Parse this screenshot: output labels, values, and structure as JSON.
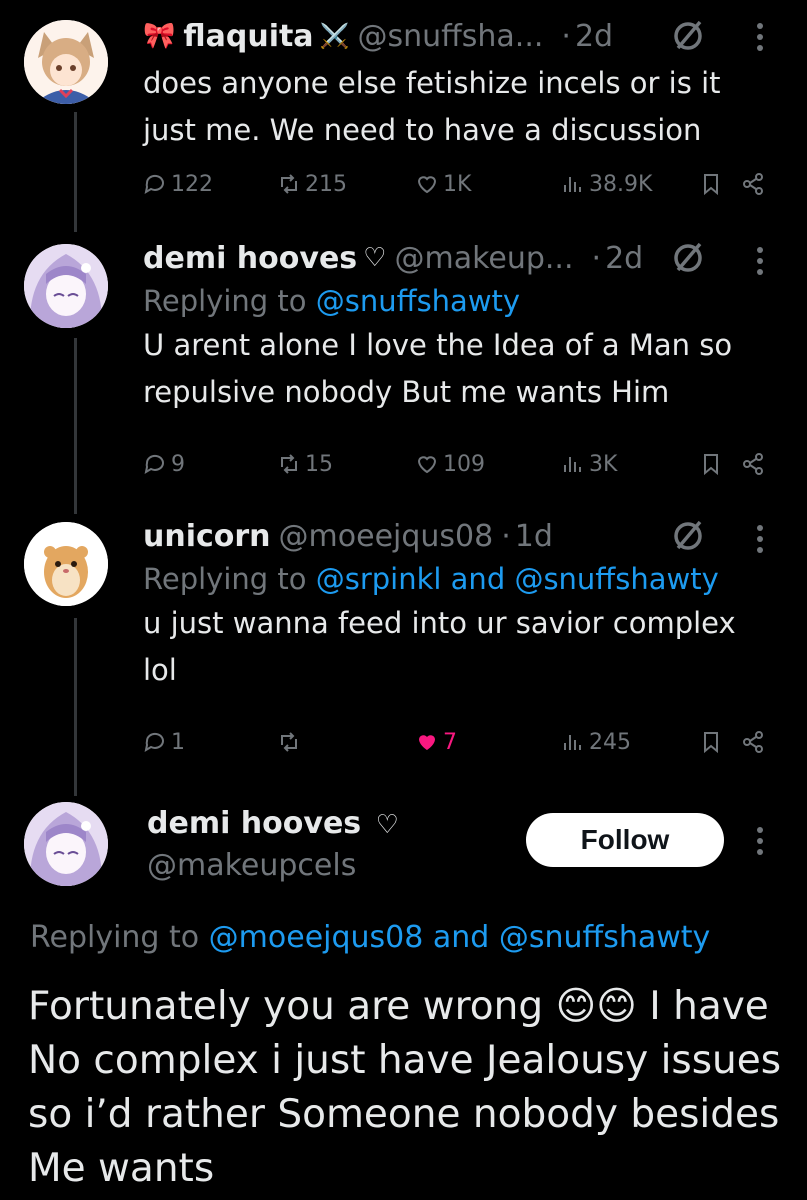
{
  "tweets": [
    {
      "emoji_prefix": "🎀",
      "name": "flaquita",
      "emoji_suffix": "⚔️",
      "handle": "@snuffsha...",
      "time": "2d",
      "reply_prefix": "",
      "reply_targets": "",
      "text_lines": [
        "does anyone else fetishize incels or is it",
        "just me. We need to have a discussion"
      ],
      "replies": "122",
      "reposts": "215",
      "likes": "1K",
      "views": "38.9K"
    },
    {
      "name": "demi hooves",
      "heart": "♡",
      "handle": "@makeup...",
      "time": "2d",
      "reply_prefix": "Replying to ",
      "reply_targets": "@snuffshawty",
      "text_lines": [
        "U arent alone I love the Idea of a Man so",
        "repulsive nobody But me wants Him"
      ],
      "replies": "9",
      "reposts": "15",
      "likes": "109",
      "views": "3K"
    },
    {
      "name": "unicorn",
      "handle": "@moeejqus08",
      "time": "1d",
      "reply_prefix": "Replying to ",
      "reply_targets": "@srpinkl and @snuffshawty",
      "text_lines": [
        "u just wanna feed into ur savior complex",
        "lol"
      ],
      "replies": "1",
      "reposts": "",
      "likes": "7",
      "views": "245"
    }
  ],
  "main_tweet": {
    "name": "demi hooves",
    "heart": "♡",
    "handle": "@makeupcels",
    "follow_label": "Follow",
    "reply_prefix": "Replying to ",
    "reply_target_1": "@moeejqus08",
    "reply_joiner": " and ",
    "reply_target_2": "@snuffshawty",
    "text_lines": [
      "Fortunately you are wrong 😊😊 I have",
      "No complex i just have Jealousy issues",
      "so i’d rather Someone nobody besides",
      "Me wants"
    ]
  },
  "icons": [
    "reply-icon",
    "repost-icon",
    "like-icon",
    "views-icon",
    "bookmark-icon",
    "share-icon",
    "grok-icon",
    "more-icon",
    "verified-slash-icon"
  ],
  "colors": {
    "background": "#000000",
    "text": "#e7e9ea",
    "muted": "#71767b",
    "link": "#1d9bf0",
    "like": "#f91880",
    "follow_bg": "#ffffff"
  }
}
